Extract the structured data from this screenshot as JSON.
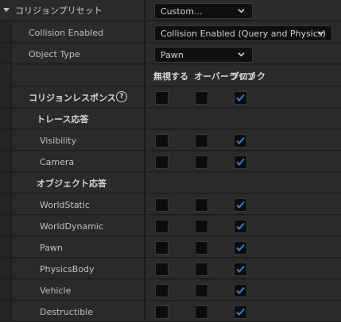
{
  "collision_presets": {
    "label": "コリジョンプリセット",
    "value": "Custom..."
  },
  "collision_enabled": {
    "label": "Collision Enabled",
    "value": "Collision Enabled (Query and Physics)"
  },
  "object_type": {
    "label": "Object Type",
    "value": "Pawn"
  },
  "columns": {
    "ignore": "無視する",
    "overlap": "オーバーラップ",
    "block": "ブロック"
  },
  "collision_responses": {
    "label": "コリジョンレスポンス",
    "help": "?",
    "ignore": false,
    "overlap": false,
    "block": true
  },
  "trace_responses": {
    "label": "トレース応答",
    "items": [
      {
        "name": "Visibility",
        "ignore": false,
        "overlap": false,
        "block": true
      },
      {
        "name": "Camera",
        "ignore": false,
        "overlap": false,
        "block": true
      }
    ]
  },
  "object_responses": {
    "label": "オブジェクト応答",
    "items": [
      {
        "name": "WorldStatic",
        "ignore": false,
        "overlap": false,
        "block": true
      },
      {
        "name": "WorldDynamic",
        "ignore": false,
        "overlap": false,
        "block": true
      },
      {
        "name": "Pawn",
        "ignore": false,
        "overlap": false,
        "block": true
      },
      {
        "name": "PhysicsBody",
        "ignore": false,
        "overlap": false,
        "block": true
      },
      {
        "name": "Vehicle",
        "ignore": false,
        "overlap": false,
        "block": true
      },
      {
        "name": "Destructible",
        "ignore": false,
        "overlap": false,
        "block": true
      }
    ]
  },
  "colors": {
    "check": "#2f7fd6",
    "panel": "#2a2a2a",
    "combo": "#0f0f0f"
  }
}
